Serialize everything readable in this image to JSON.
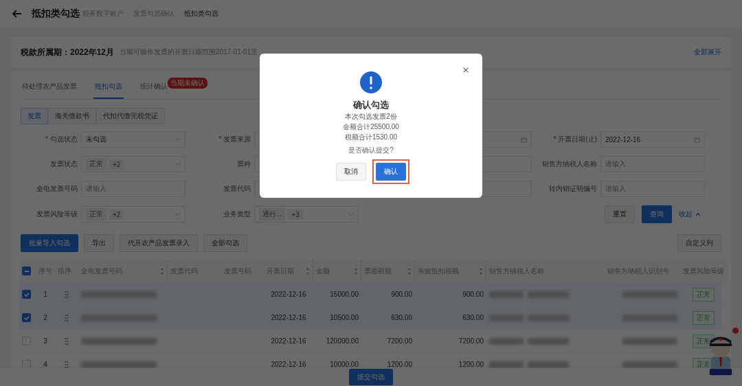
{
  "header": {
    "title": "抵扣类勾选",
    "breadcrumb": [
      "税务数字账户",
      "发票勾选确认",
      "抵扣类勾选"
    ]
  },
  "period": {
    "label": "税款所属期：2022年12月",
    "range": "当期可操作发票的开票日期范围2017-01-01至",
    "link": "全部展开"
  },
  "tabs": [
    {
      "label": "待处理农产品发票",
      "selected": false
    },
    {
      "label": "抵扣勾选",
      "selected": true
    },
    {
      "label": "统计确认",
      "selected": false,
      "badge": "当期未确认"
    }
  ],
  "subtabs": [
    {
      "label": "发票",
      "selected": true
    },
    {
      "label": "海关缴款书",
      "selected": false
    },
    {
      "label": "代扣代缴完税凭证",
      "selected": false
    }
  ],
  "filters": [
    {
      "label": "* 勾选状态",
      "kind": "select",
      "value": "未勾选"
    },
    {
      "label": "* 发票来源",
      "kind": "input"
    },
    {
      "kind": "date"
    },
    {
      "label": "* 开票日期(止)",
      "kind": "date",
      "value": "2022-12-16"
    },
    {
      "label": "发票状态",
      "kind": "tags",
      "value": "正常",
      "more": "+2"
    },
    {
      "label": "票种",
      "kind": "input"
    },
    {
      "kind": "input"
    },
    {
      "label": "销售方纳税人名称",
      "kind": "input",
      "placeholder": "请输入"
    },
    {
      "label": "全电发票号码",
      "kind": "input",
      "placeholder": "请输入"
    },
    {
      "label": "发票代码",
      "kind": "input"
    },
    {
      "kind": "input"
    },
    {
      "label": "转内销证明编号",
      "kind": "input",
      "placeholder": "请输入"
    },
    {
      "label": "发票风险等级",
      "kind": "tags",
      "value": "正常",
      "more": "+2"
    },
    {
      "label": "业务类型",
      "kind": "tags",
      "value": "通行...",
      "more": "+3"
    }
  ],
  "filter_buttons": {
    "reset": "重置",
    "search": "查询",
    "collapse": "收起"
  },
  "actions": [
    {
      "label": "批量导入勾选",
      "kind": "primary"
    },
    {
      "label": "导出",
      "kind": "default"
    },
    {
      "label": "代开农产品发票录入",
      "kind": "default"
    },
    {
      "label": "全部勾选",
      "kind": "default"
    }
  ],
  "customize": "自定义列",
  "table": {
    "select_all": {
      "indeterminate": true
    },
    "columns": [
      {
        "label": "序号",
        "sortable": false
      },
      {
        "label": "排序",
        "sortable": false
      },
      {
        "label": "全电发票号码",
        "sortable": true
      },
      {
        "label": "发票代码",
        "sortable": false
      },
      {
        "label": "发票号码",
        "sortable": false
      },
      {
        "label": "开票日期",
        "sortable": true
      },
      {
        "label": "金额",
        "sortable": true
      },
      {
        "label": "票面税额",
        "sortable": true
      },
      {
        "label": "有效抵扣税额",
        "sortable": true
      },
      {
        "label": "销售方纳税人名称",
        "sortable": false
      },
      {
        "label": "销售方纳税人识别号",
        "sortable": false
      },
      {
        "label": "发票风险等级",
        "sortable": false
      }
    ],
    "rows": [
      {
        "index": "1",
        "checked": true,
        "date": "2022-12-16",
        "amount": "15000.00",
        "tax": "900.00",
        "deductible": "900.00",
        "risk": "正常"
      },
      {
        "index": "2",
        "checked": true,
        "date": "2022-12-16",
        "amount": "10500.00",
        "tax": "630.00",
        "deductible": "630.00",
        "risk": "正常"
      },
      {
        "index": "3",
        "checked": false,
        "date": "2022-12-16",
        "amount": "120000.00",
        "tax": "7200.00",
        "deductible": "7200.00",
        "risk": "正常"
      },
      {
        "index": "4",
        "checked": false,
        "date": "2022-12-16",
        "amount": "10000.00",
        "tax": "1200.00",
        "deductible": "1200.00",
        "risk": "正常"
      }
    ]
  },
  "footer": {
    "submit": "提交勾选"
  },
  "modal": {
    "title": "确认勾选",
    "lines": [
      "本次勾选发票2份",
      "金额合计25500.00",
      "税额合计1530.00"
    ],
    "question": "是否确认提交?",
    "buttons": [
      {
        "label": "取消",
        "kind": "default",
        "highlighted": false
      },
      {
        "label": "确认",
        "kind": "primary",
        "highlighted": true
      }
    ]
  }
}
